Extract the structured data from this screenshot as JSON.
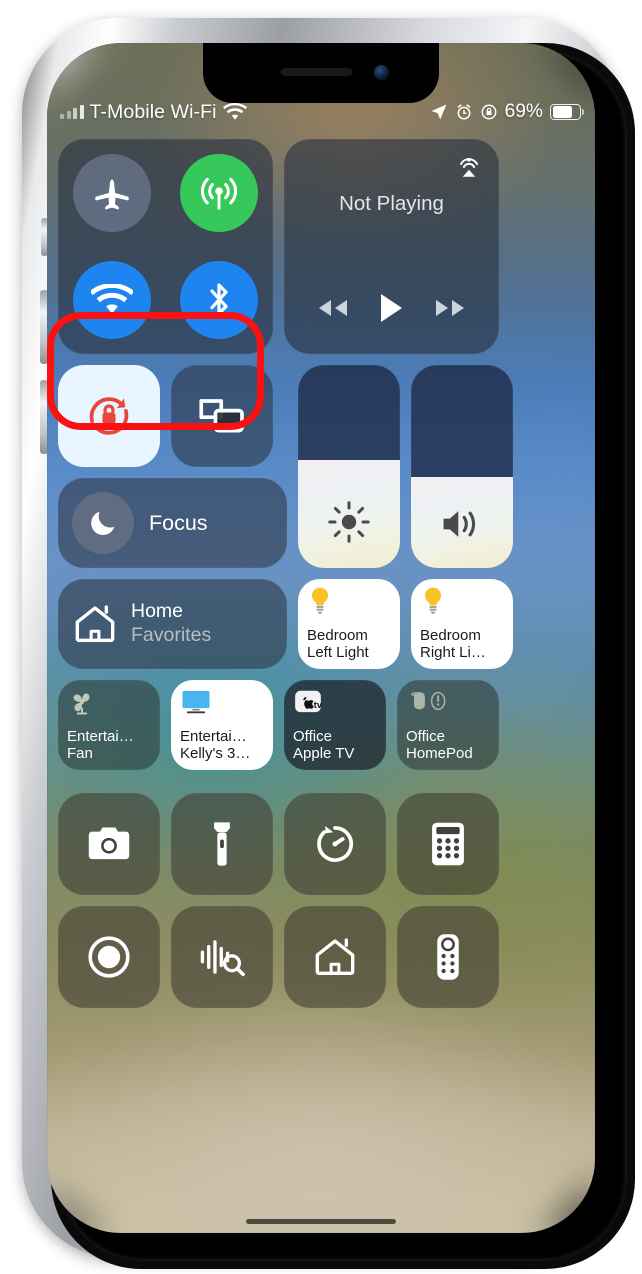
{
  "device": {
    "model": "iphone",
    "frame_color": "silver"
  },
  "status_bar": {
    "carrier": "T-Mobile Wi-Fi",
    "signal_icon": "cellular-bars-icon",
    "wifi_icon": "wifi-icon",
    "location_icon": "location-arrow-icon",
    "alarm_icon": "alarm-clock-icon",
    "rotation_lock_icon": "rotation-lock-icon",
    "battery_percent": "69%",
    "battery_level": 69,
    "battery_icon": "battery-icon"
  },
  "control_center": {
    "connectivity": {
      "airplane": {
        "name": "Airplane Mode",
        "icon": "airplane-icon",
        "state": "off"
      },
      "cellular": {
        "name": "Cellular Data",
        "icon": "cellular-antenna-icon",
        "state": "on",
        "color": "#36c85a"
      },
      "wifi": {
        "name": "Wi-Fi",
        "icon": "wifi-icon",
        "state": "on",
        "color": "#1e84f0"
      },
      "bluetooth": {
        "name": "Bluetooth",
        "icon": "bluetooth-icon",
        "state": "on",
        "color": "#1e84f0"
      }
    },
    "media": {
      "title": "Not Playing",
      "airplay_icon": "airplay-audio-icon",
      "rewind_icon": "rewind-icon",
      "play_icon": "play-icon",
      "forward_icon": "fast-forward-icon"
    },
    "rotation_lock": {
      "name": "Portrait Orientation Lock",
      "icon": "rotation-lock-icon",
      "state": "on",
      "color": "#e8453c"
    },
    "screen_mirroring": {
      "name": "Screen Mirroring",
      "icon": "screen-mirroring-icon",
      "state": "off"
    },
    "focus": {
      "label": "Focus",
      "icon": "moon-icon",
      "state": "off"
    },
    "brightness": {
      "name": "Brightness",
      "icon": "brightness-sun-icon",
      "value": 53
    },
    "volume": {
      "name": "Volume",
      "icon": "speaker-waves-icon",
      "value": 45
    },
    "home": {
      "title": "Home",
      "subtitle": "Favorites",
      "icon": "home-house-icon"
    },
    "accessories": [
      {
        "line1": "Bedroom",
        "line2": "Left Light",
        "icon": "lightbulb-icon",
        "state": "on",
        "tile_style": "white"
      },
      {
        "line1": "Bedroom",
        "line2": "Right Li…",
        "icon": "lightbulb-icon",
        "state": "on",
        "tile_style": "white"
      },
      {
        "line1": "Entertai…",
        "line2": "Fan",
        "icon": "fan-icon",
        "state": "off",
        "tile_style": "dark"
      },
      {
        "line1": "Entertai…",
        "line2": "Kelly's 3…",
        "icon": "tv-display-icon",
        "state": "on",
        "tile_style": "white"
      },
      {
        "line1": "Office",
        "line2": "Apple TV",
        "icon": "apple-tv-icon",
        "state": "off",
        "tile_style": "dark"
      },
      {
        "line1": "Office",
        "line2": "HomePod",
        "icon": "homepod-pair-icon",
        "state": "off",
        "tile_style": "dark",
        "badge": "alert"
      }
    ],
    "shortcuts_row1": [
      {
        "name": "Camera",
        "icon": "camera-icon"
      },
      {
        "name": "Flashlight",
        "icon": "flashlight-icon"
      },
      {
        "name": "Timer",
        "icon": "timer-icon"
      },
      {
        "name": "Calculator",
        "icon": "calculator-icon"
      }
    ],
    "shortcuts_row2": [
      {
        "name": "Screen Recording",
        "icon": "screen-record-icon"
      },
      {
        "name": "Music Recognition",
        "icon": "shazam-waveform-icon"
      },
      {
        "name": "Home",
        "icon": "home-house-icon"
      },
      {
        "name": "Apple TV Remote",
        "icon": "tv-remote-icon"
      }
    ]
  },
  "annotation": {
    "shape": "rounded-rectangle",
    "color": "#fb1111",
    "targets": "Wi-Fi and Bluetooth toggles"
  }
}
